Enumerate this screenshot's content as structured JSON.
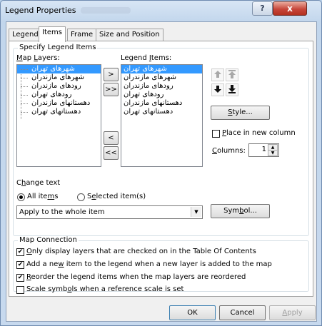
{
  "window": {
    "title": "Legend Properties",
    "help": "?",
    "close": "x"
  },
  "tabs": [
    "Legend",
    "Items",
    "Frame",
    "Size and Position"
  ],
  "specify": {
    "group_label": "Specify Legend Items",
    "map_layers_label": "Map Layers:",
    "map_layers": [
      "شهرهای تهران",
      "شهرهای مازندران",
      "رودهای مازندران",
      "رودهای تهران",
      "دهستانهای مازندران",
      "دهستانهای تهران"
    ],
    "legend_items_label": "Legend Items:",
    "legend_items": [
      "شهرهای تهران",
      "شهرهای مازندران",
      "رودهای مازندران",
      "رودهای تهران",
      "دهستانهای مازندران",
      "دهستانهای تهران"
    ],
    "move_buttons": [
      ">",
      ">>",
      "<",
      "<<"
    ],
    "style_button": "Style...",
    "place_new_column_label": "Place in new column",
    "place_new_column_checked": false,
    "columns_label": "Columns:",
    "columns_value": "1",
    "change_text_label": "Change text",
    "all_items_label": "All items",
    "selected_items_label": "Selected item(s)",
    "apply_value": "Apply to the whole item",
    "symbol_button": "Symbol..."
  },
  "map_connection": {
    "group_label": "Map Connection",
    "options": [
      {
        "label": "Only display layers that are checked on in the Table Of Contents",
        "checked": true
      },
      {
        "label": "Add a new item to the legend when a new layer is added to the map",
        "checked": true
      },
      {
        "label": "Reorder the legend items when the map layers are reordered",
        "checked": true
      },
      {
        "label": "Scale symbols when a reference scale is set",
        "checked": false
      }
    ]
  },
  "footer": {
    "ok": "OK",
    "cancel": "Cancel",
    "apply": "Apply"
  },
  "colors": {
    "selection": "#3399ff",
    "title_bar": "#c2d6ec",
    "close_button": "#c7463a"
  }
}
